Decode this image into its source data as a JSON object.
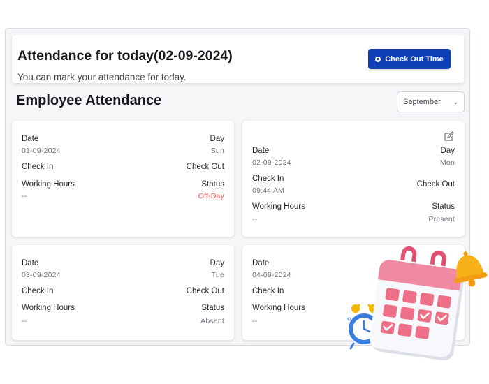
{
  "banner": {
    "title": "Attendance for today(02-09-2024)",
    "subtitle": "You can mark your attendance for today.",
    "button_label": "Check Out Time",
    "button_icon": "clock-icon"
  },
  "section": {
    "title": "Employee Attendance",
    "month": "September"
  },
  "labels": {
    "date": "Date",
    "day": "Day",
    "check_in": "Check In",
    "check_out": "Check Out",
    "working_hours": "Working Hours",
    "status": "Status"
  },
  "records": [
    {
      "date": "01-09-2024",
      "day": "Sun",
      "working_hours": "--",
      "status": "Off-Day"
    },
    {
      "date": "02-09-2024",
      "day": "Mon",
      "check_in": "09:44 AM",
      "working_hours": "--",
      "status": "Present"
    },
    {
      "date": "03-09-2024",
      "day": "Tue",
      "working_hours": "--",
      "status": "Absent"
    },
    {
      "date": "04-09-2024",
      "working_hours": "--"
    }
  ],
  "colors": {
    "accent": "#0f3fb8",
    "off_day": "#e2534b"
  }
}
